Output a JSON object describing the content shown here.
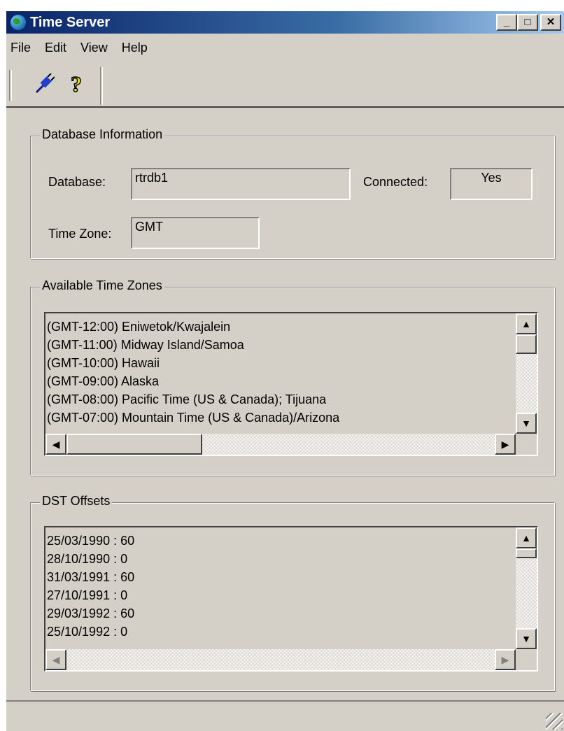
{
  "window": {
    "title": "Time Server",
    "caption_buttons": {
      "minimize": "_",
      "maximize": "□",
      "close": "✕"
    }
  },
  "menu": [
    "File",
    "Edit",
    "View",
    "Help"
  ],
  "toolbar": {
    "icons": [
      "connect-plug-icon",
      "help-question-icon"
    ]
  },
  "database_info": {
    "group_label": "Database Information",
    "database_label": "Database:",
    "database_value": "rtrdb1",
    "connected_label": "Connected:",
    "connected_value": "Yes",
    "timezone_label": "Time Zone:",
    "timezone_value": "GMT"
  },
  "time_zones": {
    "group_label": "Available Time Zones",
    "items": [
      "(GMT-12:00) Eniwetok/Kwajalein",
      "(GMT-11:00) Midway Island/Samoa",
      "(GMT-10:00) Hawaii",
      "(GMT-09:00) Alaska",
      "(GMT-08:00) Pacific Time (US & Canada); Tijuana",
      "(GMT-07:00) Mountain Time (US & Canada)/Arizona"
    ]
  },
  "dst_offsets": {
    "group_label": "DST Offsets",
    "items": [
      "25/03/1990 : 60",
      "28/10/1990 : 0",
      "31/03/1991 : 60",
      "27/10/1991 : 0",
      "29/03/1992 : 60",
      "25/10/1992 : 0"
    ]
  },
  "scroll_glyphs": {
    "up": "▲",
    "down": "▼",
    "left": "◀",
    "right": "▶"
  },
  "colors": {
    "titlebar_start": "#0a246a",
    "titlebar_end": "#a6caf0",
    "face": "#d4d0c8"
  }
}
